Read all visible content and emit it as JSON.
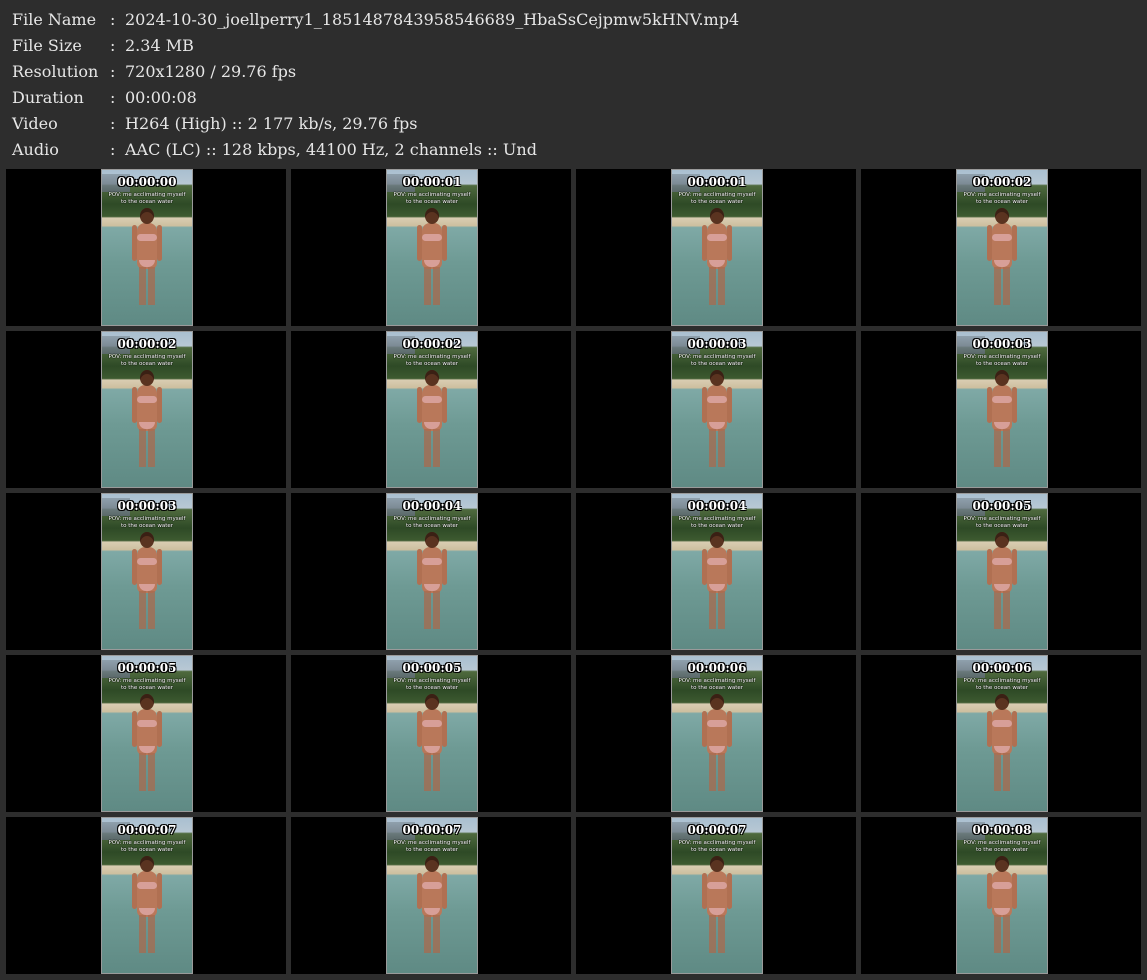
{
  "header": {
    "rows": [
      {
        "label": "File Name",
        "sep": ":",
        "value": "2024-10-30_joellperry1_1851487843958546689_HbaSsCejpmw5kHNV.mp4"
      },
      {
        "label": "File Size",
        "sep": ":",
        "value": "2.34 MB"
      },
      {
        "label": "Resolution",
        "sep": ":",
        "value": "720x1280 / 29.76 fps"
      },
      {
        "label": "Duration",
        "sep": ":",
        "value": "00:00:08"
      },
      {
        "label": "Video",
        "sep": ":",
        "value": "H264 (High) :: 2 177 kb/s, 29.76 fps"
      },
      {
        "label": "Audio",
        "sep": ":",
        "value": "AAC (LC) :: 128 kbps, 44100 Hz, 2 channels :: Und"
      }
    ]
  },
  "thumbnails": {
    "caption_line1": "POV: me acclimating myself",
    "caption_line2": "to the ocean water",
    "timestamps": [
      "00:00:00",
      "00:00:01",
      "00:00:01",
      "00:00:02",
      "00:00:02",
      "00:00:02",
      "00:00:03",
      "00:00:03",
      "00:00:03",
      "00:00:04",
      "00:00:04",
      "00:00:05",
      "00:00:05",
      "00:00:05",
      "00:00:06",
      "00:00:06",
      "00:00:07",
      "00:00:07",
      "00:00:07",
      "00:00:08"
    ]
  },
  "colors": {
    "background": "#2d2d2d",
    "header_text": "#e6e6e6",
    "cell_background": "#000000",
    "timestamp_text": "#ffffff"
  }
}
